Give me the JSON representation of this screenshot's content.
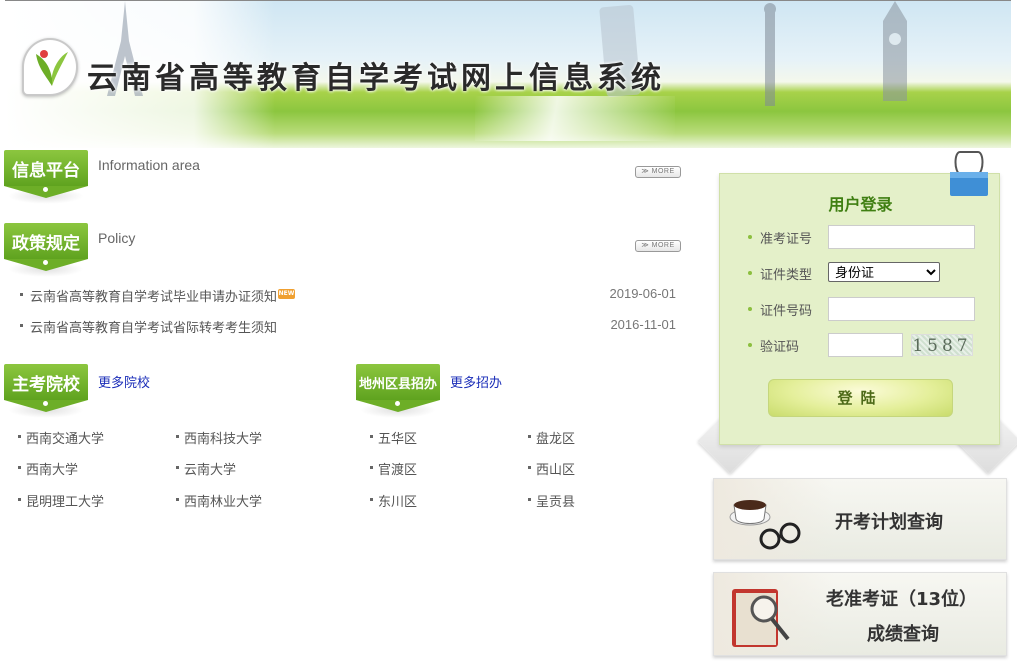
{
  "banner": {
    "site_title": "云南省高等教育自学考试网上信息系统"
  },
  "info_section": {
    "tab_label": "信息平台",
    "subtitle": "Information area",
    "more_label": "≫ MORE"
  },
  "policy_section": {
    "tab_label": "政策规定",
    "subtitle": "Policy",
    "more_label": "≫ MORE",
    "items": [
      {
        "title": "云南省高等教育自学考试毕业申请办证须知",
        "badge": "NEW",
        "date": "2019-06-01"
      },
      {
        "title": "云南省高等教育自学考试省际转考考生须知",
        "badge": "",
        "date": "2016-11-01"
      }
    ]
  },
  "schools_section": {
    "tab_label": "主考院校",
    "more_link": "更多院校",
    "items": [
      "西南交通大学",
      "西南科技大学",
      "西南大学",
      "云南大学",
      "昆明理工大学",
      "西南林业大学"
    ]
  },
  "districts_section": {
    "tab_label": "地州区县招办",
    "more_link": "更多招办",
    "items": [
      "五华区",
      "盘龙区",
      "官渡区",
      "西山区",
      "东川区",
      "呈贡县"
    ]
  },
  "login": {
    "title": "用户登录",
    "fields": {
      "exam_no_label": "准考证号",
      "exam_no_value": "",
      "id_type_label": "证件类型",
      "id_type_selected": "身份证",
      "id_no_label": "证件号码",
      "id_no_value": "",
      "captcha_label": "验证码",
      "captcha_value": "",
      "captcha_code": "1587"
    },
    "submit_label": "登陆"
  },
  "quick_links": {
    "exam_plan": "开考计划查询",
    "old_score_line1": "老准考证（13位）",
    "old_score_line2": "成绩查询"
  },
  "colors": {
    "accent_green": "#6dae27",
    "login_bg": "#e4f0c9",
    "link_blue": "#1a2db8"
  }
}
